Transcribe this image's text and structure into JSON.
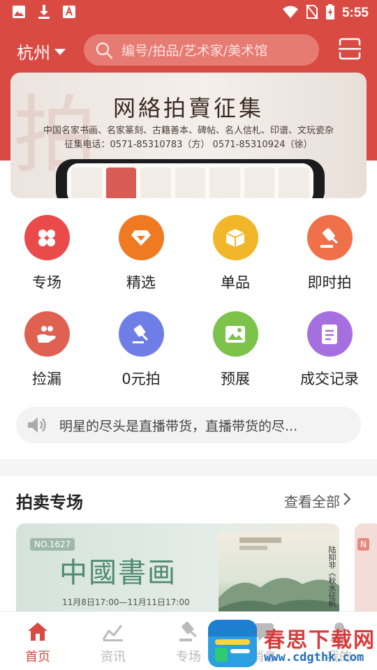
{
  "status_bar": {
    "time": "5:55"
  },
  "header": {
    "city": "杭州",
    "search_placeholder": "编号/拍品/艺术家/美术馆"
  },
  "banner": {
    "title": "网絡拍賣征集",
    "line1": "中国名家书画、名家篆刻、古籍善本、碑帖、名人信札、印谱、文玩瓷杂",
    "line2": "征集电话：0571-85310783（方） 0571-85310924（徐）"
  },
  "quick_menu": [
    {
      "label": "专场",
      "icon": "clover-icon",
      "color": "#ea4a4a"
    },
    {
      "label": "精选",
      "icon": "diamond-icon",
      "color": "#f07a22"
    },
    {
      "label": "单品",
      "icon": "box-icon",
      "color": "#f2b62a"
    },
    {
      "label": "即时拍",
      "icon": "gavel-icon",
      "color": "#f0704a"
    },
    {
      "label": "捡漏",
      "icon": "hand-coins-icon",
      "color": "#e06151"
    },
    {
      "label": "0元拍",
      "icon": "zero-auction-icon",
      "color": "#6f7ee6"
    },
    {
      "label": "预展",
      "icon": "image-icon",
      "color": "#7cc24b"
    },
    {
      "label": "成交记录",
      "icon": "record-icon",
      "color": "#a66fe0"
    }
  ],
  "notice": {
    "text": "明星的尽头是直播带货，直播带货的尽..."
  },
  "section": {
    "title": "拍卖专场",
    "more": "查看全部"
  },
  "auction_card": {
    "number": "NO.1627",
    "title": "中國書画",
    "date": "11月8日17:00—11月11日17:00",
    "side_text": "陆抑非《秋水征帆",
    "next_number": "N"
  },
  "tab_bar": [
    {
      "label": "首页",
      "active": true
    },
    {
      "label": "资讯",
      "active": false
    },
    {
      "label": "专场",
      "active": false
    },
    {
      "label": "消息",
      "active": false
    },
    {
      "label": "我的",
      "active": false
    }
  ],
  "watermark": {
    "title": "春思下载网",
    "url": "www.cdgthk.com"
  },
  "colors": {
    "brand_red": "#d94a43"
  }
}
